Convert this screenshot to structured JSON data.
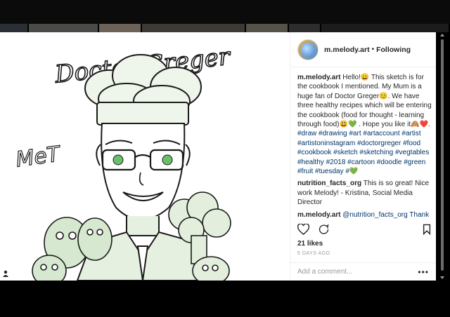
{
  "post": {
    "username": "m.melody.art",
    "separator": "•",
    "follow_status": "Following"
  },
  "caption": {
    "username": "m.melody.art",
    "text": "Hello!😀 This sketch is for the cookbook I mentioned. My Mum is a huge fan of Doctor Greger😊. We have three healthy recipes which will be entering the cookbook (food for thought - learning through food)😃💚 . Hope you like it🙈❤️.",
    "hashtags": "#draw #drawing #art #artaccount #artist #artistoninstagram #doctorgreger #food #cookbook #sketch #sketching #vegtables #healthy #2018 #cartoon #doodle #green #fruit #tuesday #💚"
  },
  "comments": [
    {
      "username": "nutrition_facts_org",
      "text": "This is so great! Nice work Melody! - Kristina, Social Media Director"
    },
    {
      "username": "m.melody.art",
      "text": "@nutrition_facts_org Thank"
    }
  ],
  "likes": "21 likes",
  "time_ago": "5 DAYS AGO",
  "comment_placeholder": "Add a comment...",
  "more_label": "•••",
  "artwork": {
    "title": "Doctor Greger",
    "signature": "MeT"
  },
  "icons": {
    "like": "heart-icon",
    "comment": "comment-icon",
    "save": "bookmark-icon",
    "user": "person-icon"
  },
  "colors": {
    "accent_green": "#4caf50",
    "hashtag": "#003569"
  }
}
